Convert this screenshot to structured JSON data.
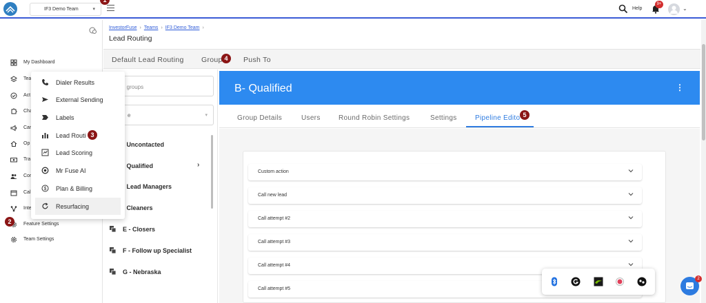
{
  "topbar": {
    "team_select": "IF3 Demo Team",
    "help_label": "Help",
    "notification_count": "9+"
  },
  "sidebar": {
    "items": [
      {
        "label": "My Dashboard",
        "icon": "dashboard-icon"
      },
      {
        "label": "Tea",
        "icon": "layers-icon"
      },
      {
        "label": "Act",
        "icon": "check-circle-icon"
      },
      {
        "label": "Cha",
        "icon": "puzzle-icon"
      },
      {
        "label": "Car",
        "icon": "megaphone-icon"
      },
      {
        "label": "Op",
        "icon": "home-icon"
      },
      {
        "label": "Tra",
        "icon": "money-icon"
      },
      {
        "label": "Cor",
        "icon": "contacts-icon"
      },
      {
        "label": "Cal",
        "icon": "calendar-icon"
      },
      {
        "label": "Inte",
        "icon": "integrations-icon"
      },
      {
        "label": "Feature Settings",
        "icon": "gear-icon"
      },
      {
        "label": "Team Settings",
        "icon": "gear-icon"
      }
    ]
  },
  "flyout": {
    "items": [
      {
        "label": "Dialer Results",
        "icon": "phone-icon"
      },
      {
        "label": "External Sending",
        "icon": "send-icon"
      },
      {
        "label": "Labels",
        "icon": "label-icon"
      },
      {
        "label": "Lead Routi",
        "icon": "bar-chart-icon"
      },
      {
        "label": "Lead Scoring",
        "icon": "scoring-icon"
      },
      {
        "label": "Mr Fuse AI",
        "icon": "ai-icon"
      },
      {
        "label": "Plan & Billing",
        "icon": "dollar-icon"
      },
      {
        "label": "Resurfacing",
        "icon": "refresh-icon"
      }
    ]
  },
  "breadcrumb": {
    "items": [
      "InvestorFuse",
      "Teams",
      "IF3 Demo Team"
    ],
    "page_title": "Lead Routing"
  },
  "top_tabs": [
    "Default Lead Routing",
    "Group",
    "Push To"
  ],
  "groups": {
    "search_placeholder": "ch groups",
    "select_value": "e",
    "items": [
      {
        "label": "- Uncontacted"
      },
      {
        "label": "- Qualified",
        "chevron": "›"
      },
      {
        "label": "- Lead Managers"
      },
      {
        "label": "- Cleaners"
      },
      {
        "label": "E - Closers"
      },
      {
        "label": "F - Follow up Specialist"
      },
      {
        "label": "G - Nebraska"
      }
    ]
  },
  "main": {
    "group_title": "B- Qualified",
    "sub_tabs": [
      "Group Details",
      "Users",
      "Round Robin Settings",
      "Settings",
      "Pipeline Edito"
    ],
    "active_sub_tab": "Pipeline Edito",
    "accordion": [
      "Custom action",
      "Call new lead",
      "Call attempt #2",
      "Call attempt #3",
      "Call attempt #4",
      "Call attempt #5"
    ]
  },
  "tray": {
    "icons": [
      "bluetooth-icon",
      "grammarly-icon",
      "nvidia-icon",
      "extension-icon",
      "tasks-icon"
    ]
  },
  "chat_badge": "2",
  "steps": [
    "1",
    "2",
    "3",
    "4",
    "5"
  ],
  "colors": {
    "accent_blue": "#2d8af0",
    "link_blue": "#2e5bd8",
    "step_marker": "#8b1515",
    "badge_red": "#d32f2f"
  }
}
